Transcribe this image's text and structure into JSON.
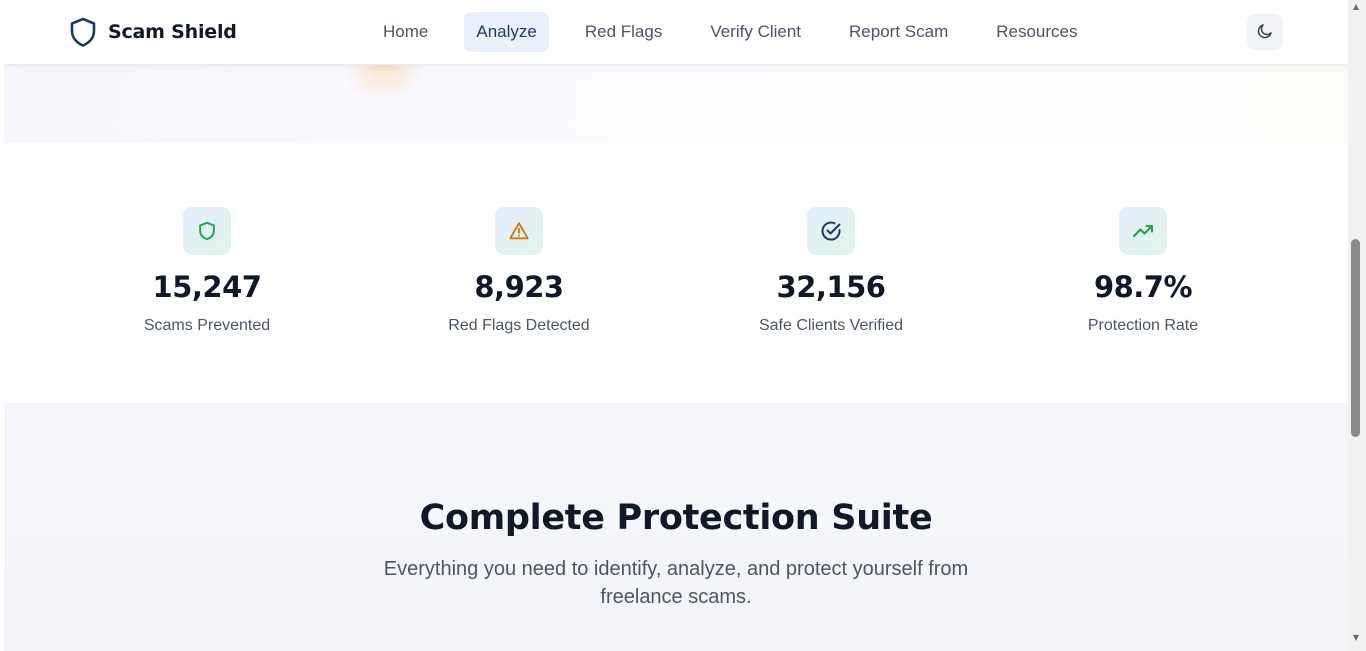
{
  "brand": {
    "name": "Scam Shield",
    "icon": "shield-icon"
  },
  "nav": {
    "items": [
      {
        "label": "Home",
        "active": false
      },
      {
        "label": "Analyze",
        "active": true
      },
      {
        "label": "Red Flags",
        "active": false
      },
      {
        "label": "Verify Client",
        "active": false
      },
      {
        "label": "Report Scam",
        "active": false
      },
      {
        "label": "Resources",
        "active": false
      }
    ],
    "theme_toggle_icon": "moon-icon"
  },
  "stats": [
    {
      "value": "15,247",
      "label": "Scams Prevented",
      "icon": "shield-icon",
      "color": "#16a34a"
    },
    {
      "value": "8,923",
      "label": "Red Flags Detected",
      "icon": "warning-triangle-icon",
      "color": "#d97706"
    },
    {
      "value": "32,156",
      "label": "Safe Clients Verified",
      "icon": "check-circle-icon",
      "color": "#1e3a5f"
    },
    {
      "value": "98.7%",
      "label": "Protection Rate",
      "icon": "trending-up-icon",
      "color": "#16a34a"
    }
  ],
  "suite": {
    "title": "Complete Protection Suite",
    "subtitle": "Everything you need to identify, analyze, and protect yourself from freelance scams."
  },
  "colors": {
    "brand_dark": "#1e3a5f",
    "active_nav_bg": "#eaf0fb"
  }
}
